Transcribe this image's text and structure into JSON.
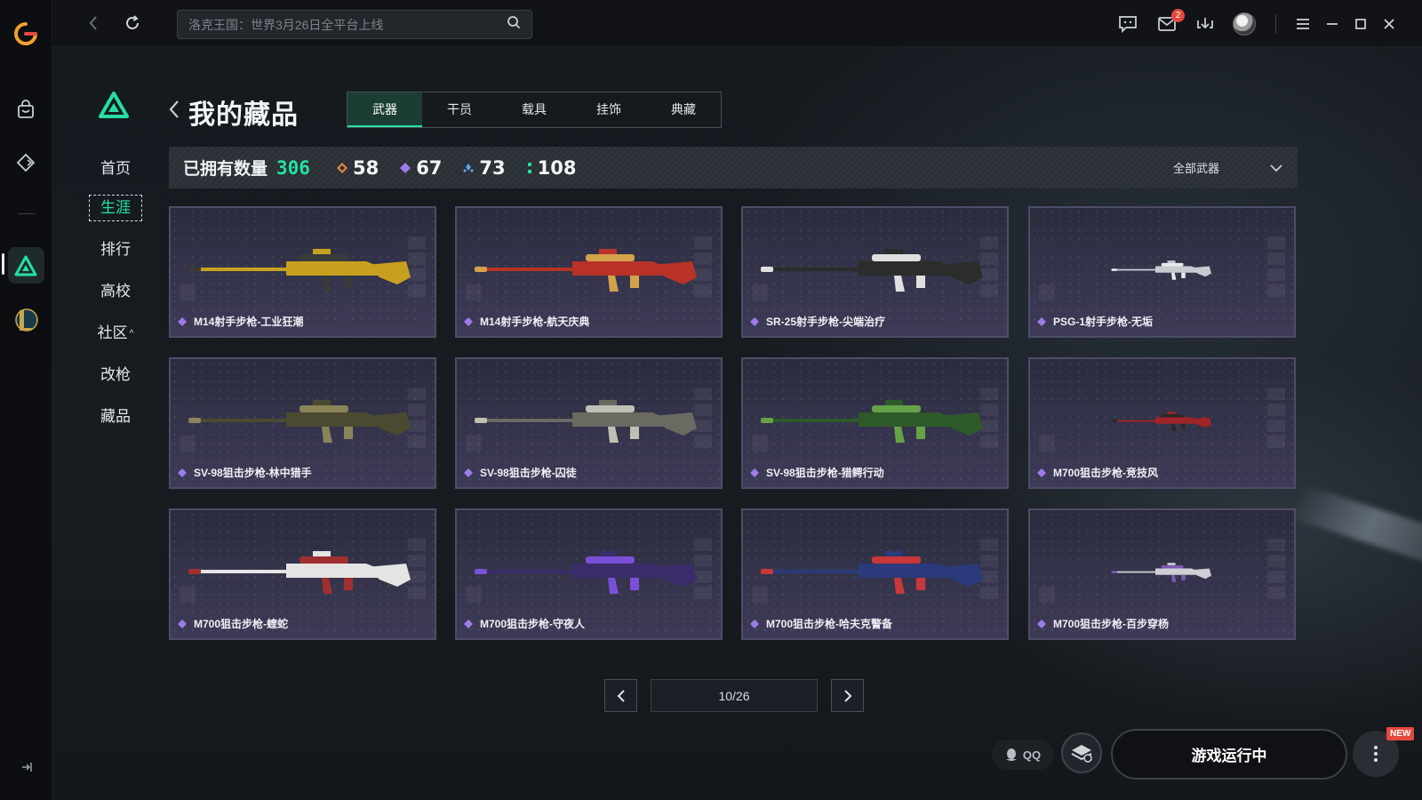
{
  "topbar": {
    "search_placeholder": "洛克王国：世界3月26日全平台上线",
    "mail_badge": "2"
  },
  "sidebar": {
    "items": [
      {
        "label": "首页"
      },
      {
        "label": "生涯"
      },
      {
        "label": "排行"
      },
      {
        "label": "高校"
      },
      {
        "label": "社区"
      },
      {
        "label": "改枪"
      },
      {
        "label": "藏品"
      }
    ],
    "active_index": 1
  },
  "page": {
    "title": "我的藏品",
    "tabs": [
      {
        "label": "武器"
      },
      {
        "label": "干员"
      },
      {
        "label": "载具"
      },
      {
        "label": "挂饰"
      },
      {
        "label": "典藏"
      }
    ],
    "active_tab": 0
  },
  "stats": {
    "owned_label": "已拥有数量",
    "total": "306",
    "counts": [
      {
        "value": "58",
        "color": "#e08a3a",
        "icon": "orange-gem-icon"
      },
      {
        "value": "67",
        "color": "#9d7ce8",
        "icon": "purple-gem-icon"
      },
      {
        "value": "73",
        "color": "#5aa9e6",
        "icon": "blue-gem-icon"
      },
      {
        "value": "108",
        "color": "#25e0a2",
        "icon": "green-gem-icon"
      }
    ],
    "filter_label": "全部武器"
  },
  "items": [
    {
      "name": "M14射手步枪-工业狂潮",
      "gun_color": "#c8a020",
      "accent": "#3a3a3a"
    },
    {
      "name": "M14射手步枪-航天庆典",
      "gun_color": "#b83228",
      "accent": "#d4a24a"
    },
    {
      "name": "SR-25射手步枪-尖端治疗",
      "gun_color": "#2a2d2a",
      "accent": "#e0e0e0"
    },
    {
      "name": "PSG-1射手步枪-无垢",
      "gun_color": "#c8ccd2",
      "accent": "#e8eaee"
    },
    {
      "name": "SV-98狙击步枪-林中猎手",
      "gun_color": "#4b4a30",
      "accent": "#8a8458"
    },
    {
      "name": "SV-98狙击步枪-囚徒",
      "gun_color": "#6a6a62",
      "accent": "#bfbfb4"
    },
    {
      "name": "SV-98狙击步枪-猎鳄行动",
      "gun_color": "#2e5a2a",
      "accent": "#66a248"
    },
    {
      "name": "M700狙击步枪-竞技风",
      "gun_color": "#a02428",
      "accent": "#2a2a2a"
    },
    {
      "name": "M700狙击步枪-蝰蛇",
      "gun_color": "#e4e4e4",
      "accent": "#a03030"
    },
    {
      "name": "M700狙击步枪-守夜人",
      "gun_color": "#3a2d6a",
      "accent": "#7a50d8"
    },
    {
      "name": "M700狙击步枪-哈夫克警备",
      "gun_color": "#2a3a7a",
      "accent": "#c83838"
    },
    {
      "name": "M700狙击步枪-百步穿杨",
      "gun_color": "#cfcfd6",
      "accent": "#7a5ab0"
    }
  ],
  "rarity_color": "#9d7ce8",
  "pagination": {
    "page": "10/26"
  },
  "bottom": {
    "qq_label": "QQ",
    "launch_label": "游戏运行中",
    "new_badge": "NEW"
  },
  "colors": {
    "accent": "#25e0a2"
  }
}
